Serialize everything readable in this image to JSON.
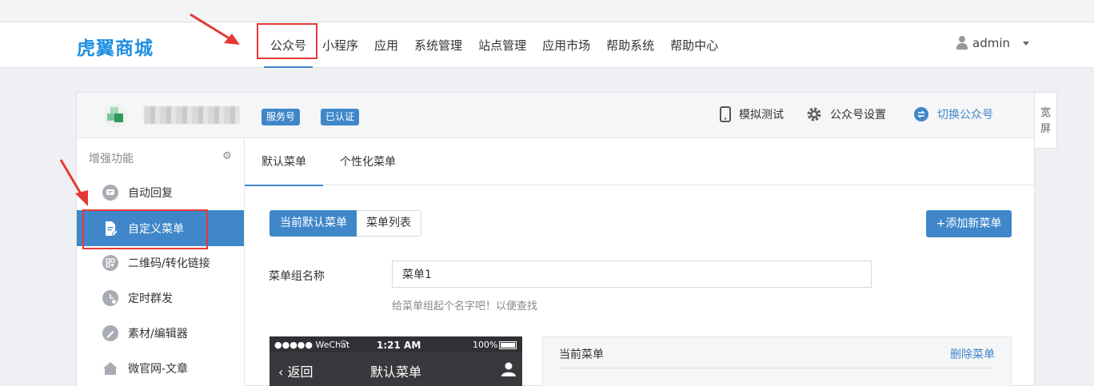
{
  "brand": {
    "logo_text": "虎翼商城",
    "accent": "#3f87c9",
    "logo_color": "#1d8fe0"
  },
  "nav": {
    "items": [
      {
        "label": "公众号",
        "active": true
      },
      {
        "label": "小程序"
      },
      {
        "label": "应用"
      },
      {
        "label": "系统管理"
      },
      {
        "label": "站点管理"
      },
      {
        "label": "应用市场"
      },
      {
        "label": "帮助系统"
      },
      {
        "label": "帮助中心"
      }
    ]
  },
  "user": {
    "name": "admin",
    "icon": "user-icon"
  },
  "account": {
    "tags": [
      "服务号",
      "已认证"
    ],
    "tools": {
      "simulate": "模拟测试",
      "settings": "公众号设置",
      "switch": "切换公众号"
    }
  },
  "wide_toggle": {
    "line1": "宽",
    "line2": "屏"
  },
  "sidebar": {
    "heading": "增强功能",
    "items": [
      {
        "label": "自动回复",
        "icon": "chat-bubble-icon"
      },
      {
        "label": "自定义菜单",
        "icon": "document-edit-icon",
        "active": true
      },
      {
        "label": "二维码/转化链接",
        "icon": "qrcode-icon"
      },
      {
        "label": "定时群发",
        "icon": "clock-icon"
      },
      {
        "label": "素材/编辑器",
        "icon": "pencil-icon"
      },
      {
        "label": "微官网-文章",
        "icon": "home-icon"
      }
    ]
  },
  "tabs": [
    {
      "label": "默认菜单",
      "active": true
    },
    {
      "label": "个性化菜单"
    }
  ],
  "segment": {
    "current": "当前默认菜单",
    "list": "菜单列表"
  },
  "add_button": "+添加新菜单",
  "form": {
    "label": "菜单组名称",
    "value": "菜单1",
    "hint": "给菜单组起个名字吧！以便查找"
  },
  "phone": {
    "carrier": "●●●●● WeChat",
    "time": "1:21 AM",
    "battery": "100%",
    "back": "返回",
    "title": "默认菜单"
  },
  "menu_panel": {
    "title": "当前菜单",
    "delete": "删除菜单"
  }
}
